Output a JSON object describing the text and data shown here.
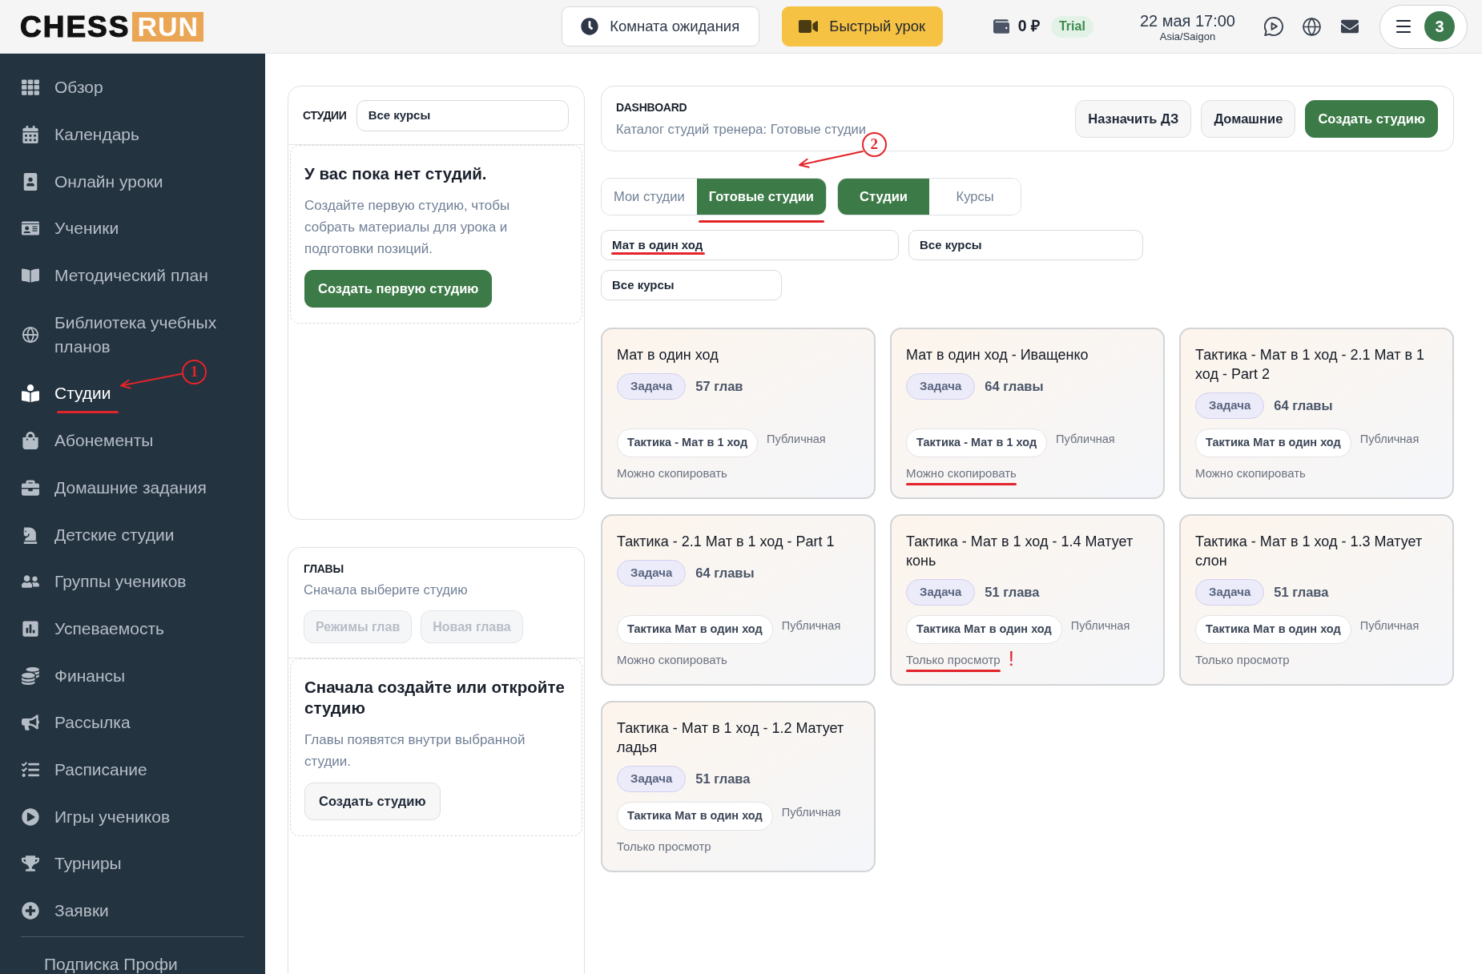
{
  "top_bar": {
    "logo": {
      "main": "CHESS",
      "accent": "RUN"
    },
    "buttons": [
      {
        "label": "Комната ожидания",
        "kind": "outline"
      },
      {
        "label": "Быстрый урок",
        "kind": "accent"
      }
    ],
    "balance": "0 ₽",
    "plan": "Trial",
    "datetime": "22 мая 17:00",
    "timezone": "Asia/Saigon",
    "avatar": "3"
  },
  "sidebar": {
    "items": [
      {
        "label": "Обзор",
        "selected": false,
        "underlined": false
      },
      {
        "label": "Календарь",
        "selected": false,
        "underlined": false
      },
      {
        "label": "Онлайн уроки",
        "selected": false,
        "underlined": false
      },
      {
        "label": "Ученики",
        "selected": false,
        "underlined": false
      },
      {
        "label": "Методический план",
        "selected": false,
        "underlined": false
      },
      {
        "label": "Библиотека учебных планов",
        "selected": false,
        "underlined": false
      },
      {
        "label": "Студии",
        "selected": true,
        "underlined": true,
        "callout": "1"
      },
      {
        "label": "Абонементы",
        "selected": false,
        "underlined": false
      },
      {
        "label": "Домашние задания",
        "selected": false,
        "underlined": false
      },
      {
        "label": "Детские студии",
        "selected": false,
        "underlined": false
      },
      {
        "label": "Группы учеников",
        "selected": false,
        "underlined": false
      },
      {
        "label": "Успеваемость",
        "selected": false,
        "underlined": false
      },
      {
        "label": "Финансы",
        "selected": false,
        "underlined": false
      },
      {
        "label": "Рассылка",
        "selected": false,
        "underlined": false
      },
      {
        "label": "Расписание",
        "selected": false,
        "underlined": false
      },
      {
        "label": "Игры учеников",
        "selected": false,
        "underlined": false
      },
      {
        "label": "Турниры",
        "selected": false,
        "underlined": false
      },
      {
        "label": "Заявки",
        "selected": false,
        "underlined": false
      }
    ],
    "footer": "Подписка Профи"
  },
  "studios_panel": {
    "title": "СТУДИИ",
    "filter": {
      "value": "Все курсы"
    },
    "empty_state": {
      "title": "У вас пока нет студий.",
      "text": "Создайте первую студию, чтобы собрать материалы для урока и подготовки позиций.",
      "button": "Создать первую студию"
    }
  },
  "chapters_panel": {
    "title": "ГЛАВЫ",
    "subtitle": "Сначала выберите студию",
    "buttons": [
      {
        "label": "Режимы глав",
        "disabled": true
      },
      {
        "label": "Новая глава",
        "disabled": true
      }
    ],
    "empty_state": {
      "title": "Сначала создайте или откройте студию",
      "text": "Главы появятся внутри выбранной студии.",
      "button": "Создать студию"
    }
  },
  "dashboard_header": {
    "eyebrow": "DASHBOARD",
    "subtitle": "Каталог студий тренера: Готовые студии",
    "buttons": [
      {
        "label": "Назначить ДЗ",
        "kind": "secondary"
      },
      {
        "label": "Домашние",
        "kind": "secondary"
      },
      {
        "label": "Создать студию",
        "kind": "primary"
      }
    ]
  },
  "catalog_tabs": [
    {
      "label": "Мои студии",
      "selected": false,
      "underlined": false
    },
    {
      "label": "Готовые студии",
      "selected": true,
      "underlined": true,
      "callout": "2"
    }
  ],
  "view_tabs": [
    {
      "label": "Студии",
      "selected": true
    },
    {
      "label": "Курсы",
      "selected": false
    }
  ],
  "filters": [
    {
      "value": "Мат в один ход",
      "underlined": true
    },
    {
      "value": "Все курсы",
      "underlined": false
    },
    {
      "value": "Все курсы",
      "underlined": false
    }
  ],
  "cards": [
    {
      "title": "Мат в один ход",
      "type": "Задача",
      "chapters": "57 глав",
      "tag": "Тактика - Мат в 1 ход",
      "visibility": "Публичная",
      "access": "Можно скопировать",
      "underlined": false
    },
    {
      "title": "Мат в один ход - Иващенко",
      "type": "Задача",
      "chapters": "64 главы",
      "tag": "Тактика - Мат в 1 ход",
      "visibility": "Публичная",
      "access": "Можно скопировать",
      "underlined": true
    },
    {
      "title": "Тактика - Мат в 1 ход - 2.1 Мат в 1 ход - Part 2",
      "type": "Задача",
      "chapters": "64 главы",
      "tag": "Тактика Мат в один ход",
      "visibility": "Публичная",
      "access": "Можно скопировать",
      "underlined": false
    },
    {
      "title": "Тактика - 2.1 Мат в 1 ход - Part 1",
      "type": "Задача",
      "chapters": "64 главы",
      "tag": "Тактика Мат в один ход",
      "visibility": "Публичная",
      "access": "Можно скопировать",
      "underlined": false
    },
    {
      "title": "Тактика - Мат в 1 ход - 1.4 Матует конь",
      "type": "Задача",
      "chapters": "51 глава",
      "tag": "Тактика Мат в один ход",
      "visibility": "Публичная",
      "access": "Только просмотр",
      "underlined": true,
      "mark": "!"
    },
    {
      "title": "Тактика - Мат в 1 ход - 1.3 Матует слон",
      "type": "Задача",
      "chapters": "51 глава",
      "tag": "Тактика Мат в один ход",
      "visibility": "Публичная",
      "access": "Только просмотр",
      "underlined": false
    },
    {
      "title": "Тактика - Мат в 1 ход - 1.2 Матует ладья",
      "type": "Задача",
      "chapters": "51 глава",
      "tag": "Тактика Мат в один ход",
      "visibility": "Публичная",
      "access": "Только просмотр",
      "underlined": false
    }
  ]
}
